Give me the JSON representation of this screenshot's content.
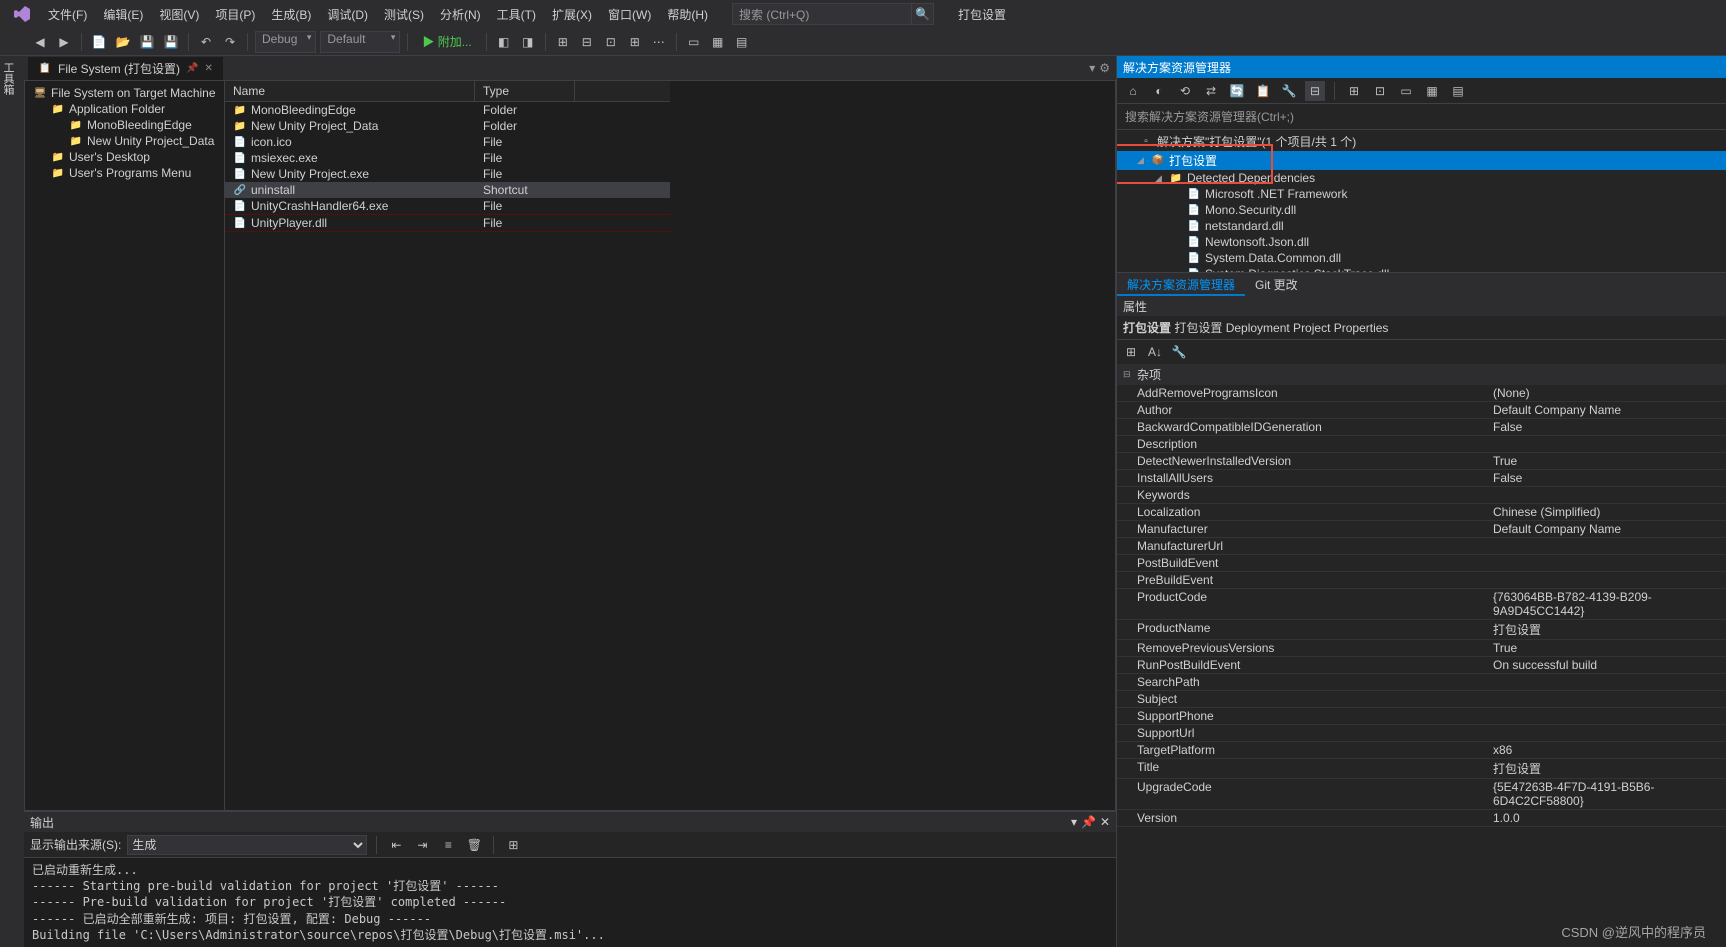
{
  "menus": [
    "文件(F)",
    "编辑(E)",
    "视图(V)",
    "项目(P)",
    "生成(B)",
    "调试(D)",
    "测试(S)",
    "分析(N)",
    "工具(T)",
    "扩展(X)",
    "窗口(W)",
    "帮助(H)"
  ],
  "search_placeholder": "搜索 (Ctrl+Q)",
  "window_title": "打包设置",
  "toolbar": {
    "config": "Debug",
    "platform": "Default",
    "start": "▶ 附加..."
  },
  "left_rail": "工具箱",
  "doc_tab": {
    "label": "File System (打包设置)"
  },
  "fs": {
    "tree": [
      {
        "label": "File System on Target Machine",
        "depth": 0,
        "icon": "computer"
      },
      {
        "label": "Application Folder",
        "depth": 1,
        "icon": "folder"
      },
      {
        "label": "MonoBleedingEdge",
        "depth": 2,
        "icon": "folder"
      },
      {
        "label": "New Unity Project_Data",
        "depth": 2,
        "icon": "folder"
      },
      {
        "label": "User's Desktop",
        "depth": 1,
        "icon": "folder"
      },
      {
        "label": "User's Programs Menu",
        "depth": 1,
        "icon": "folder"
      }
    ],
    "columns": {
      "name": "Name",
      "type": "Type"
    },
    "rows": [
      {
        "name": "MonoBleedingEdge",
        "type": "Folder",
        "icon": "folder"
      },
      {
        "name": "New Unity Project_Data",
        "type": "Folder",
        "icon": "folder"
      },
      {
        "name": "icon.ico",
        "type": "File",
        "icon": "file"
      },
      {
        "name": "msiexec.exe",
        "type": "File",
        "icon": "file"
      },
      {
        "name": "New Unity Project.exe",
        "type": "File",
        "icon": "file"
      },
      {
        "name": "uninstall",
        "type": "Shortcut",
        "icon": "shortcut",
        "selected": true
      },
      {
        "name": "UnityCrashHandler64.exe",
        "type": "File",
        "icon": "file",
        "red": true
      },
      {
        "name": "UnityPlayer.dll",
        "type": "File",
        "icon": "file",
        "red": true
      }
    ]
  },
  "output": {
    "title": "输出",
    "source_label": "显示输出来源(S):",
    "source_value": "生成",
    "text": "已启动重新生成...\n------ Starting pre-build validation for project '打包设置' ------\n------ Pre-build validation for project '打包设置' completed ------\n------ 已启动全部重新生成: 项目: 打包设置, 配置: Debug ------\nBuilding file 'C:\\Users\\Administrator\\source\\repos\\打包设置\\Debug\\打包设置.msi'..."
  },
  "solution": {
    "title": "解决方案资源管理器",
    "search_placeholder": "搜索解决方案资源管理器(Ctrl+;)",
    "root": "解决方案\"打包设置\"(1 个项目/共 1 个)",
    "project": "打包设置",
    "folder": "Detected Dependencies",
    "deps": [
      "Microsoft .NET Framework",
      "Mono.Security.dll",
      "netstandard.dll",
      "Newtonsoft.Json.dll",
      "System.Data.Common.dll",
      "System.Diagnostics.StackTrace.dll"
    ],
    "tabs": {
      "active": "解决方案资源管理器",
      "other": "Git 更改"
    }
  },
  "properties": {
    "title": "属性",
    "object": "打包设置 Deployment Project Properties",
    "category": "杂项",
    "rows": [
      {
        "n": "AddRemoveProgramsIcon",
        "v": "(None)"
      },
      {
        "n": "Author",
        "v": "Default Company Name"
      },
      {
        "n": "BackwardCompatibleIDGeneration",
        "v": "False"
      },
      {
        "n": "Description",
        "v": ""
      },
      {
        "n": "DetectNewerInstalledVersion",
        "v": "True"
      },
      {
        "n": "InstallAllUsers",
        "v": "False"
      },
      {
        "n": "Keywords",
        "v": ""
      },
      {
        "n": "Localization",
        "v": "Chinese (Simplified)"
      },
      {
        "n": "Manufacturer",
        "v": "Default Company Name"
      },
      {
        "n": "ManufacturerUrl",
        "v": ""
      },
      {
        "n": "PostBuildEvent",
        "v": ""
      },
      {
        "n": "PreBuildEvent",
        "v": ""
      },
      {
        "n": "ProductCode",
        "v": "{763064BB-B782-4139-B209-9A9D45CC1442}"
      },
      {
        "n": "ProductName",
        "v": "打包设置"
      },
      {
        "n": "RemovePreviousVersions",
        "v": "True"
      },
      {
        "n": "RunPostBuildEvent",
        "v": "On successful build"
      },
      {
        "n": "SearchPath",
        "v": ""
      },
      {
        "n": "Subject",
        "v": ""
      },
      {
        "n": "SupportPhone",
        "v": ""
      },
      {
        "n": "SupportUrl",
        "v": ""
      },
      {
        "n": "TargetPlatform",
        "v": "x86"
      },
      {
        "n": "Title",
        "v": "打包设置"
      },
      {
        "n": "UpgradeCode",
        "v": "{5E47263B-4F7D-4191-B5B6-6D4C2CF58800}"
      },
      {
        "n": "Version",
        "v": "1.0.0"
      }
    ]
  },
  "watermark": "CSDN @逆风中的程序员"
}
